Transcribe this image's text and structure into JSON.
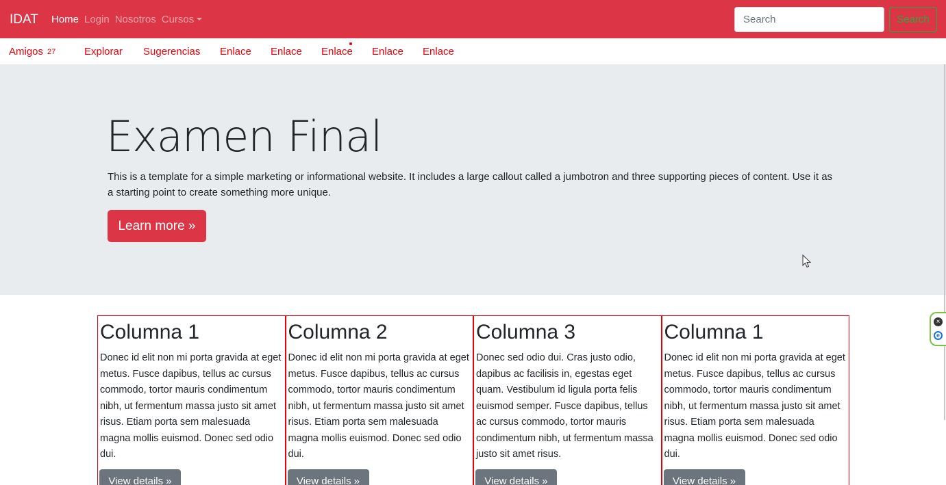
{
  "navbar": {
    "brand": "IDAT",
    "links": [
      {
        "label": "Home",
        "active": true
      },
      {
        "label": "Login",
        "active": false
      },
      {
        "label": "Nosotros",
        "active": false
      },
      {
        "label": "Cursos",
        "active": false,
        "dropdown": true
      }
    ],
    "search_placeholder": "Search",
    "search_button": "Search",
    "color": "#dc3545"
  },
  "subnav": {
    "items": [
      {
        "label": "Amigos",
        "badge": "27"
      },
      {
        "label": "Explorar"
      },
      {
        "label": "Sugerencias"
      },
      {
        "label": "Enlace"
      },
      {
        "label": "Enlace"
      },
      {
        "label": "Enlace",
        "dot": true
      },
      {
        "label": "Enlace"
      },
      {
        "label": "Enlace"
      }
    ],
    "link_color": "#e8000a"
  },
  "jumbotron": {
    "title": "Examen Final",
    "text": "This is a template for a simple marketing or informational website. It includes a large callout called a jumbotron and three supporting pieces of content. Use it as a starting point to create something more unique.",
    "button": "Learn more »"
  },
  "columns": [
    {
      "title": "Columna 1",
      "text": "Donec id elit non mi porta gravida at eget metus. Fusce dapibus, tellus ac cursus commodo, tortor mauris condimentum nibh, ut fermentum massa justo sit amet risus. Etiam porta sem malesuada magna mollis euismod. Donec sed odio dui.",
      "button": "View details »"
    },
    {
      "title": "Columna 2",
      "text": "Donec id elit non mi porta gravida at eget metus. Fusce dapibus, tellus ac cursus commodo, tortor mauris condimentum nibh, ut fermentum massa justo sit amet risus. Etiam porta sem malesuada magna mollis euismod. Donec sed odio dui.",
      "button": "View details »"
    },
    {
      "title": "Columna 3",
      "text": "Donec sed odio dui. Cras justo odio, dapibus ac facilisis in, egestas eget quam. Vestibulum id ligula porta felis euismod semper. Fusce dapibus, tellus ac cursus commodo, tortor mauris condimentum nibh, ut fermentum massa justo sit amet risus.",
      "button": "View details »"
    },
    {
      "title": "Columna 1",
      "text": "Donec id elit non mi porta gravida at eget metus. Fusce dapibus, tellus ac cursus commodo, tortor mauris condimentum nibh, ut fermentum massa justo sit amet risus. Etiam porta sem malesuada magna mollis euismod. Donec sed odio dui.",
      "button": "View details »"
    }
  ],
  "icons": {
    "cursor": "mouse-pointer-icon",
    "widget_close": "close-icon",
    "widget_ext": "extension-icon"
  }
}
